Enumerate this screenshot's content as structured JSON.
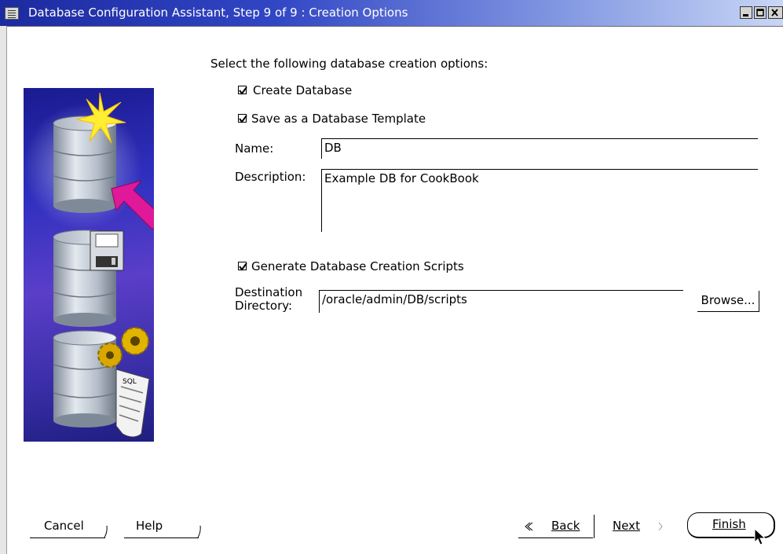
{
  "window": {
    "title": "Database Configuration Assistant, Step 9 of 9 : Creation Options"
  },
  "prompt": "Select the following database creation options:",
  "options": {
    "create_database": {
      "label": "Create Database",
      "checked": true
    },
    "save_template": {
      "label": "Save as a Database Template",
      "checked": true
    },
    "generate_scripts": {
      "label": "Generate Database Creation Scripts",
      "checked": true
    }
  },
  "template": {
    "name_label": "Name:",
    "name_value": "DB",
    "description_label": "Description:",
    "description_value": "Example DB for CookBook"
  },
  "destination": {
    "label_line1": "Destination",
    "label_line2": "Directory:",
    "value": "/oracle/admin/DB/scripts",
    "browse_label": "Browse..."
  },
  "buttons": {
    "cancel": "Cancel",
    "help": "Help",
    "back": "Back",
    "next": "Next",
    "finish": "Finish"
  },
  "illustration": {
    "icons": [
      "database-star-icon",
      "arrow-icon",
      "database-floppy-icon",
      "database-gears-icon",
      "sql-scroll-icon"
    ],
    "sql_text": "SQL"
  },
  "colors": {
    "titlebar_start": "#1c2aa0",
    "titlebar_end": "#c9d6f6",
    "illustration_bg": "#3030c0",
    "arrow": "#e0189a",
    "star": "#ffee33"
  }
}
